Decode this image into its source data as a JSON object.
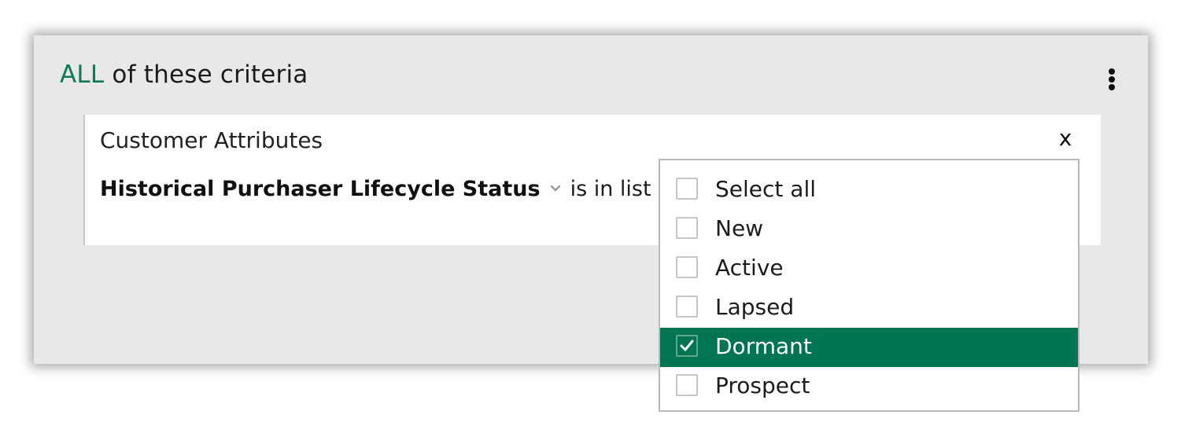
{
  "group": {
    "quantifier": "ALL",
    "title_rest": " of these criteria",
    "menu_icon": "kebab-menu-icon"
  },
  "card": {
    "title": "Customer Attributes",
    "close_label": "x",
    "attribute": "Historical Purchaser Lifecycle Status",
    "chevron_icon": "chevron-down-icon",
    "operator": "is in list"
  },
  "dropdown": {
    "options": [
      {
        "label": "Select all",
        "checked": false
      },
      {
        "label": "New",
        "checked": false
      },
      {
        "label": "Active",
        "checked": false
      },
      {
        "label": "Lapsed",
        "checked": false
      },
      {
        "label": "Dormant",
        "checked": true
      },
      {
        "label": "Prospect",
        "checked": false
      }
    ]
  },
  "colors": {
    "accent": "#007552",
    "accent_text": "#0d7a52",
    "panel_bg": "#e8e8e8"
  }
}
